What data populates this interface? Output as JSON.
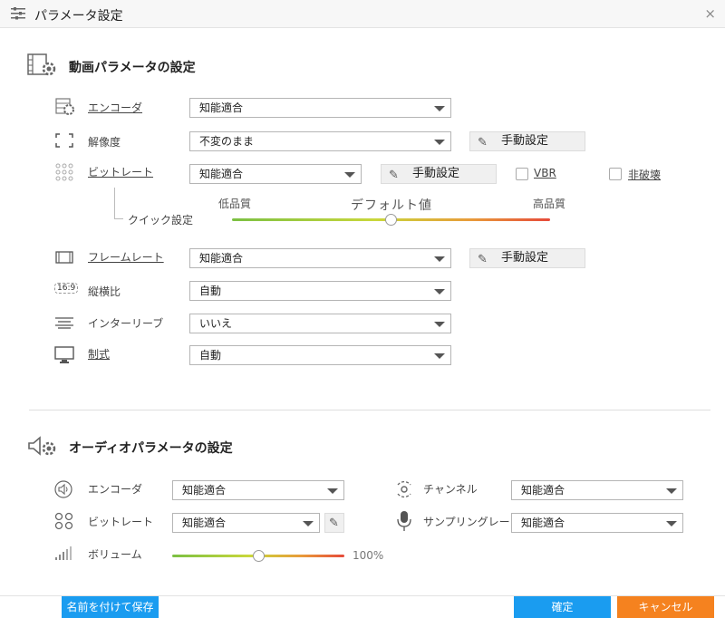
{
  "window": {
    "title": "パラメータ設定",
    "close_glyph": "×"
  },
  "video": {
    "title": "動画パラメータの設定",
    "encoder": {
      "label": "エンコーダ",
      "value": "知能適合"
    },
    "resolution": {
      "label": "解像度",
      "value": "不変のまま",
      "button": "手動設定"
    },
    "bitrate": {
      "label": "ビットレート",
      "value": "知能適合",
      "button": "手動設定",
      "vbr_label": "VBR",
      "lossless_label": "非破壊"
    },
    "quick": {
      "label": "クイック設定",
      "low": "低品質",
      "high": "高品質",
      "default": "デフォルト値",
      "level": 0.5
    },
    "framerate": {
      "label": "フレームレート",
      "value": "知能適合",
      "button": "手動設定"
    },
    "aspect": {
      "label": "縦横比",
      "value": "自動",
      "icon_text": "16:9"
    },
    "interlace": {
      "label": "インターリーブ",
      "value": "いいえ"
    },
    "format": {
      "label": "制式",
      "value": "自動"
    }
  },
  "audio": {
    "title": "オーディオパラメータの設定",
    "encoder": {
      "label": "エンコーダ",
      "value": "知能適合"
    },
    "bitrate": {
      "label": "ビットレート",
      "value": "知能適合"
    },
    "volume": {
      "label": "ボリューム",
      "value_text": "100%",
      "level": 0.5
    },
    "channel": {
      "label": "チャンネル",
      "value": "知能適合"
    },
    "samplerate": {
      "label": "サンプリングレート",
      "value": "知能適合"
    }
  },
  "footer": {
    "save_as": "名前を付けて保存",
    "ok": "確定",
    "cancel": "キャンセル"
  },
  "colors": {
    "primary_blue": "#1a9cf0",
    "cancel_orange": "#f5821f"
  }
}
